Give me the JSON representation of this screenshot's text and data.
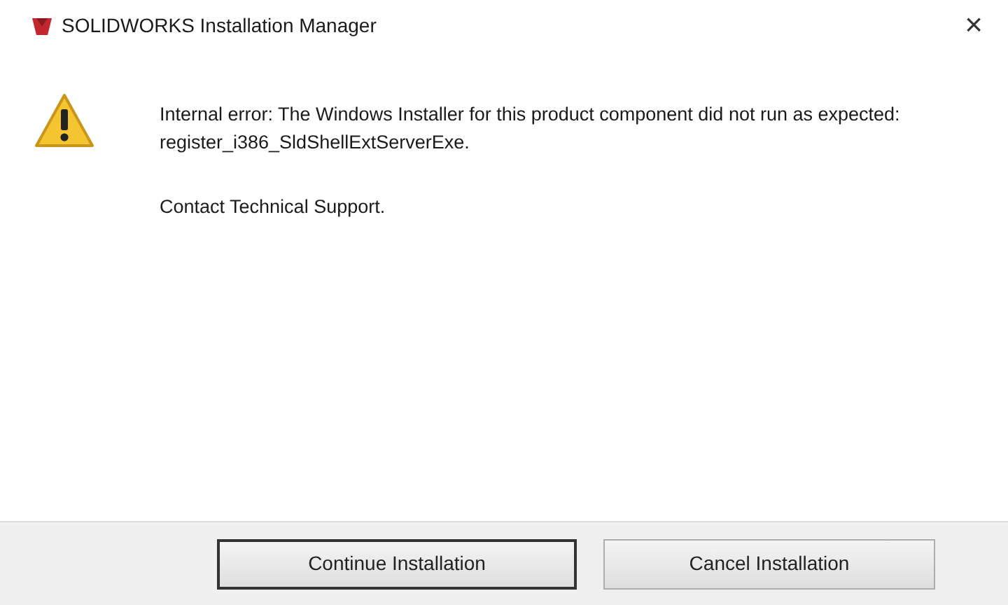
{
  "window": {
    "title": "SOLIDWORKS Installation Manager",
    "close": "×"
  },
  "message": {
    "kind": "warning",
    "lines": [
      "Internal error: The Windows Installer for this product component did not run as expected: register_i386_SldShellExtServerExe.",
      "Contact Technical Support."
    ]
  },
  "buttons": [
    {
      "label": "Continue Installation",
      "focused": true
    },
    {
      "label": "Cancel Installation",
      "focused": false
    }
  ]
}
